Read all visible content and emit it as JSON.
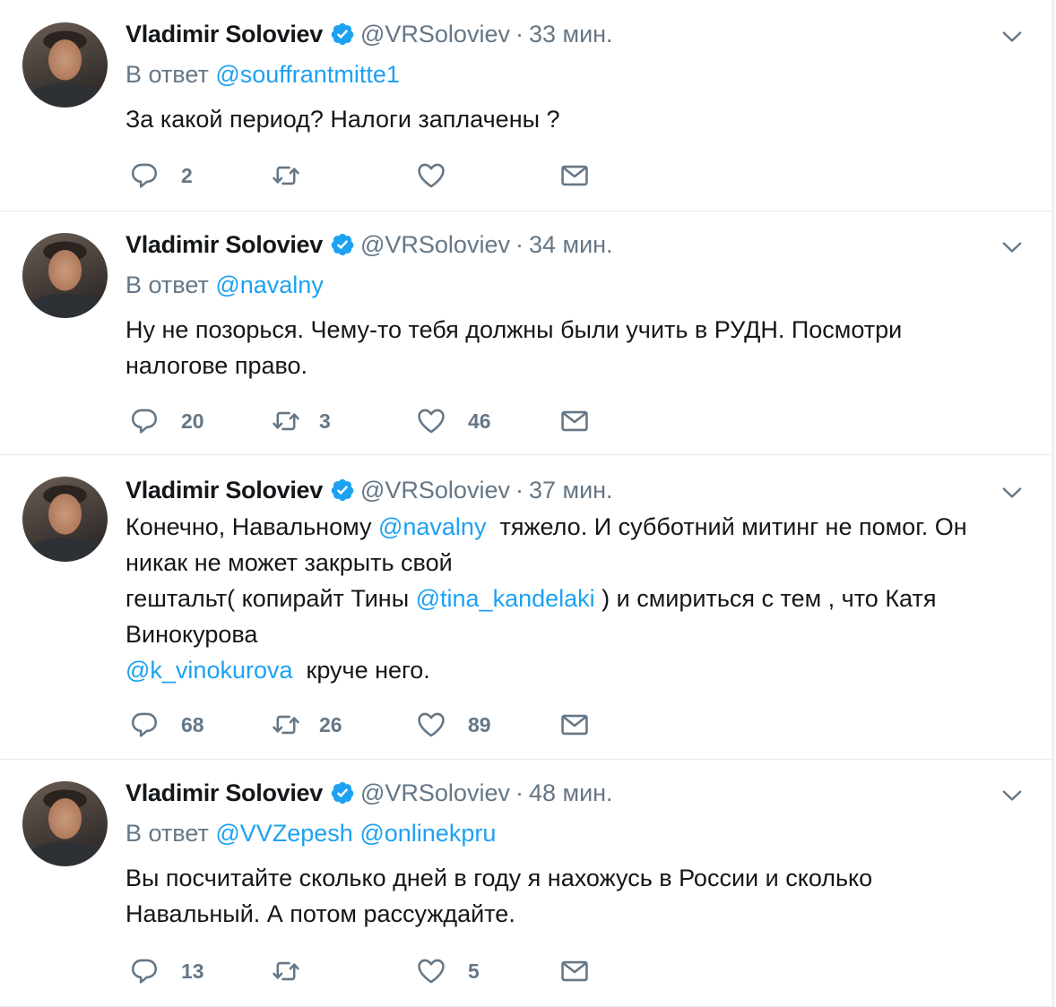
{
  "tweets": [
    {
      "name": "Vladimir Soloviev",
      "handle": "@VRSoloviev",
      "time": "33 мин.",
      "reply_prefix": "В ответ",
      "reply_to": "@souffrantmitte1",
      "text": "За какой период? Налоги заплачены ?",
      "replies": "2",
      "retweets": "",
      "likes": ""
    },
    {
      "name": "Vladimir Soloviev",
      "handle": "@VRSoloviev",
      "time": "34 мин.",
      "reply_prefix": "В ответ",
      "reply_to": "@navalny",
      "text_line1": "Ну не позорься. Чему-то тебя должны были учить в РУДН. Посмотри",
      "text_line2": "налогове право.",
      "replies": "20",
      "retweets": "3",
      "likes": "46"
    },
    {
      "name": "Vladimir Soloviev",
      "handle": "@VRSoloviev",
      "time": "37 мин.",
      "text_a": "Конечно, Навальному ",
      "mention_a": "@navalny",
      "text_b": "  тяжело. И субботний митинг не помог. Он",
      "text_c": "никак не может закрыть свой",
      "text_d": "гештальт( копирайт Тины ",
      "mention_b": "@tina_kandelaki",
      "text_e": " ) и смириться с тем , что Катя",
      "text_f": "Винокурова",
      "mention_c": "@k_vinokurova",
      "text_g": "  круче него.",
      "replies": "68",
      "retweets": "26",
      "likes": "89"
    },
    {
      "name": "Vladimir Soloviev",
      "handle": "@VRSoloviev",
      "time": "48 мин.",
      "reply_prefix": "В ответ",
      "reply_to_1": "@VVZepesh",
      "reply_to_2": "@onlinekpru",
      "text_line1": "Вы посчитайте сколько дней в году я нахожусь в России и сколько",
      "text_line2": "Навальный. А потом рассуждайте.",
      "replies": "13",
      "retweets": "",
      "likes": "5"
    }
  ],
  "colors": {
    "accent": "#1da1f2",
    "secondary_text": "#657786",
    "primary_text": "#14171a",
    "divider": "#e6ecf0"
  },
  "icons": {
    "verified": "verified-badge-icon",
    "more": "chevron-down-icon",
    "reply": "reply-bubble-icon",
    "retweet": "retweet-icon",
    "like": "heart-icon",
    "dm": "envelope-icon"
  }
}
